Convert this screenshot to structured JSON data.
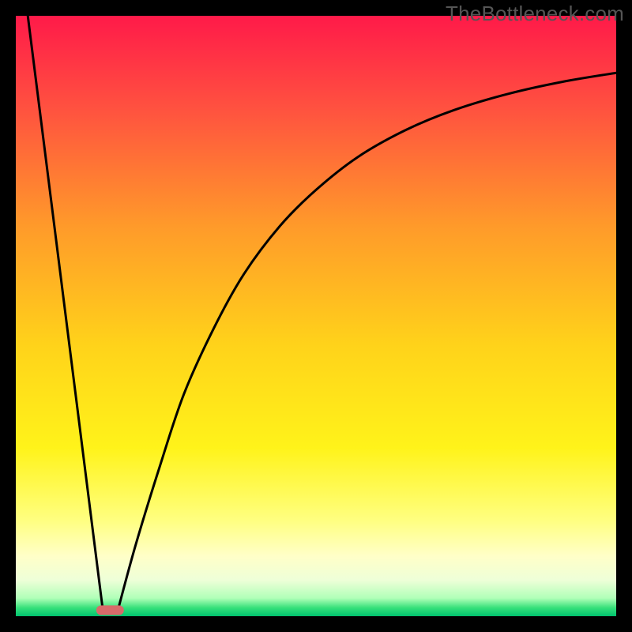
{
  "watermark": "TheBottleneck.com",
  "chart_data": {
    "type": "line",
    "title": "",
    "xlabel": "",
    "ylabel": "",
    "xlim": [
      0,
      100
    ],
    "ylim": [
      0,
      100
    ],
    "grid": false,
    "legend": false,
    "background_gradient_stops": [
      {
        "offset": 0.0,
        "color": "#ff1a49"
      },
      {
        "offset": 0.15,
        "color": "#ff5040"
      },
      {
        "offset": 0.35,
        "color": "#ff9a2a"
      },
      {
        "offset": 0.55,
        "color": "#ffd31a"
      },
      {
        "offset": 0.72,
        "color": "#fff31a"
      },
      {
        "offset": 0.84,
        "color": "#ffff80"
      },
      {
        "offset": 0.9,
        "color": "#ffffc8"
      },
      {
        "offset": 0.94,
        "color": "#eeffd8"
      },
      {
        "offset": 0.97,
        "color": "#b0ffb8"
      },
      {
        "offset": 0.986,
        "color": "#36e07a"
      },
      {
        "offset": 1.0,
        "color": "#00c26f"
      }
    ],
    "series": [
      {
        "name": "left-segment",
        "x": [
          2,
          14.5
        ],
        "y": [
          100,
          1
        ]
      },
      {
        "name": "right-segment",
        "x": [
          17,
          20,
          24,
          28,
          33,
          38,
          44,
          50,
          57,
          65,
          73,
          82,
          91,
          100
        ],
        "y": [
          1,
          12,
          25,
          37,
          48,
          57,
          65,
          71,
          76.5,
          81,
          84.3,
          87,
          89,
          90.5
        ]
      }
    ],
    "marker": {
      "shape": "rounded-rect",
      "x": 15.7,
      "y": 1.0,
      "width": 4.6,
      "height": 1.6,
      "fill": "#d86a6a"
    }
  }
}
